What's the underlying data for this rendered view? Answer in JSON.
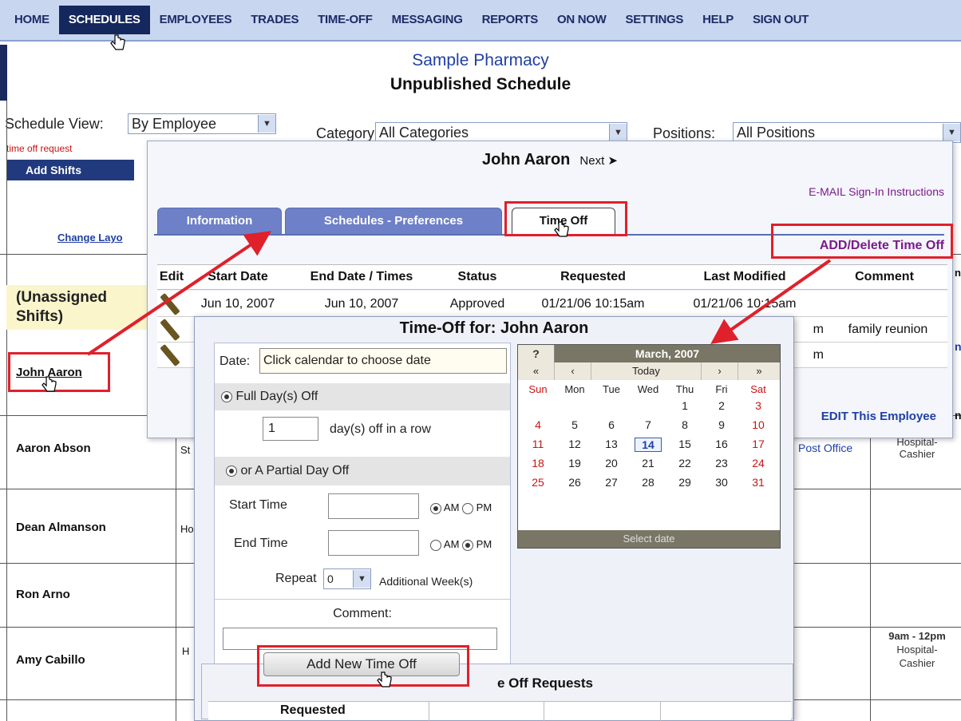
{
  "nav": [
    "HOME",
    "SCHEDULES",
    "EMPLOYEES",
    "TRADES",
    "TIME-OFF",
    "MESSAGING",
    "REPORTS",
    "ON NOW",
    "SETTINGS",
    "HELP",
    "SIGN OUT"
  ],
  "header": {
    "company": "Sample Pharmacy",
    "subtitle": "Unpublished Schedule"
  },
  "filters": {
    "view_label": "Schedule View:",
    "view_value": "By Employee",
    "category_label": "Category:",
    "category_value": "All Categories",
    "positions_label": "Positions:",
    "positions_value": "All Positions"
  },
  "left": {
    "time_off_request": "time off request",
    "add_shifts": "Add Shifts",
    "change_layout": "Change Layo",
    "unassigned_line1": "(Unassigned",
    "unassigned_line2": "Shifts)"
  },
  "employees": [
    "John Aaron",
    "Aaron Abson",
    "Dean Almanson",
    "Ron Arno",
    "Amy Cabillo"
  ],
  "grid": {
    "partial_st": "St",
    "partial_ho": "Ho",
    "partial_h": "H",
    "post_office": "Post Office",
    "cell1_top": "Hospital-",
    "cell1_bottom": "Cashier",
    "cell2_time": "9am - 12pm",
    "cell2_line1": "Hospital-",
    "cell2_line2": "Cashier",
    "edge_n1": "n",
    "edge_n2": "n",
    "edge_n3": "n"
  },
  "employee_dialog": {
    "name": "John Aaron",
    "next": "Next ➤",
    "email_link": "E-MAIL Sign-In Instructions",
    "tabs": [
      "Information",
      "Schedules - Preferences",
      "Time Off"
    ],
    "add_delete": "ADD/Delete Time Off",
    "edit_employee": "EDIT This Employee",
    "columns": [
      "Edit",
      "Start Date",
      "End Date / Times",
      "Status",
      "Requested",
      "Last Modified",
      "Comment"
    ],
    "rows": [
      {
        "start": "Jun 10, 2007",
        "end": "Jun 10, 2007",
        "status": "Approved",
        "requested": "01/21/06 10:15am",
        "modified": "01/21/06 10:15am",
        "comment": ""
      },
      {
        "start": "",
        "end": "",
        "status": "",
        "requested": "",
        "modified": "m",
        "comment": "family reunion"
      },
      {
        "start": "",
        "end": "",
        "status": "",
        "requested": "",
        "modified": "m",
        "comment": ""
      }
    ]
  },
  "timeoff_dialog": {
    "title": "Time-Off for:  John Aaron",
    "date_label": "Date:",
    "date_placeholder": "Click calendar to choose date",
    "full_day": "Full Day(s) Off",
    "days_value": "1",
    "days_suffix": "day(s) off in a row",
    "partial": "or A Partial Day Off",
    "start_time": "Start Time",
    "end_time": "End Time",
    "am": "AM",
    "pm": "PM",
    "repeat": "Repeat",
    "repeat_value": "0",
    "additional_weeks": "Additional Week(s)",
    "comment": "Comment:",
    "add_button": "Add New Time Off",
    "requests_heading": "e Off Requests",
    "requested_col": "Requested"
  },
  "calendar": {
    "help": "?",
    "month": "March, 2007",
    "nav": [
      "«",
      "‹",
      "Today",
      "›",
      "»"
    ],
    "weekdays": [
      "Sun",
      "Mon",
      "Tue",
      "Wed",
      "Thu",
      "Fri",
      "Sat"
    ],
    "first_weekday": 4,
    "days_in_month": 31,
    "selected": 14,
    "footer": "Select date"
  },
  "colors": {
    "nav_active": "#14285e",
    "highlight": "#e0202a",
    "link_purple": "#7a1a8a",
    "link_blue": "#1f3fa6"
  }
}
